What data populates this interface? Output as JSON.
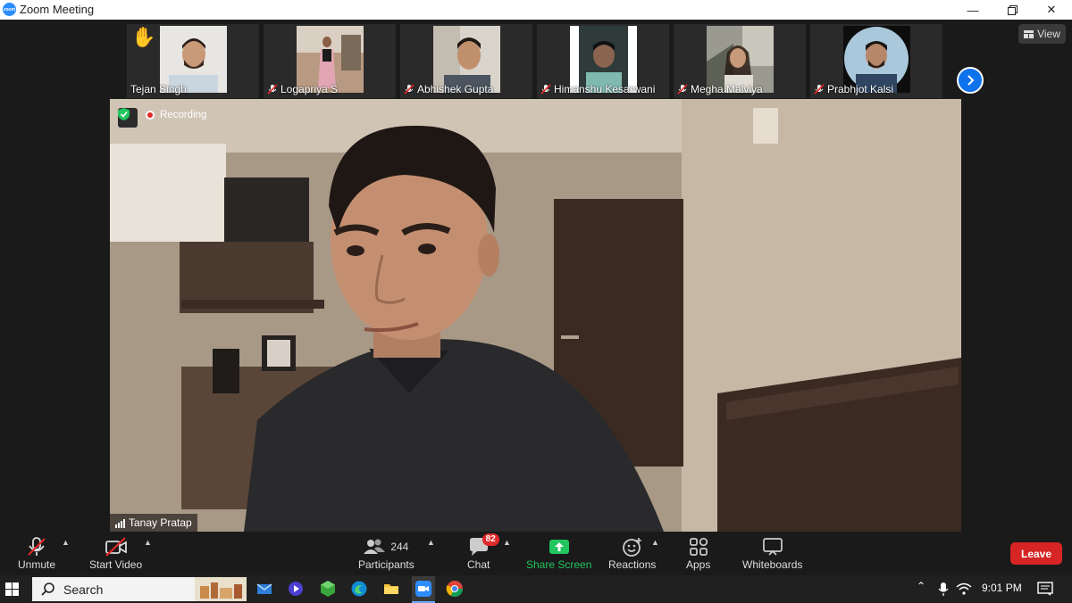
{
  "window": {
    "title": "Zoom Meeting",
    "logo_text": "zoom"
  },
  "strip": {
    "participants": [
      {
        "name": "Tejan Singh",
        "muted": false,
        "hand_raised": true
      },
      {
        "name": "Logapriya S",
        "muted": true,
        "hand_raised": false
      },
      {
        "name": "Abhishek Gupta",
        "muted": true,
        "hand_raised": false
      },
      {
        "name": "Himanshu Kesarwani",
        "muted": true,
        "hand_raised": false
      },
      {
        "name": "Megha Malviya",
        "muted": true,
        "hand_raised": false
      },
      {
        "name": "Prabhjot Kalsi",
        "muted": true,
        "hand_raised": false
      }
    ],
    "view_label": "View"
  },
  "main": {
    "recording_label": "Recording",
    "speaker_name": "Tanay Pratap"
  },
  "toolbar": {
    "unmute_label": "Unmute",
    "start_video_label": "Start Video",
    "participants_label": "Participants",
    "participants_count": "244",
    "chat_label": "Chat",
    "chat_badge": "82",
    "share_label": "Share Screen",
    "reactions_label": "Reactions",
    "apps_label": "Apps",
    "whiteboards_label": "Whiteboards",
    "leave_label": "Leave"
  },
  "taskbar": {
    "search_label": "Search",
    "clock": "9:01 PM"
  },
  "colors": {
    "accent_blue": "#0e72ed",
    "share_green": "#22c55e",
    "leave_red": "#d72525",
    "badge_red": "#e02828"
  }
}
